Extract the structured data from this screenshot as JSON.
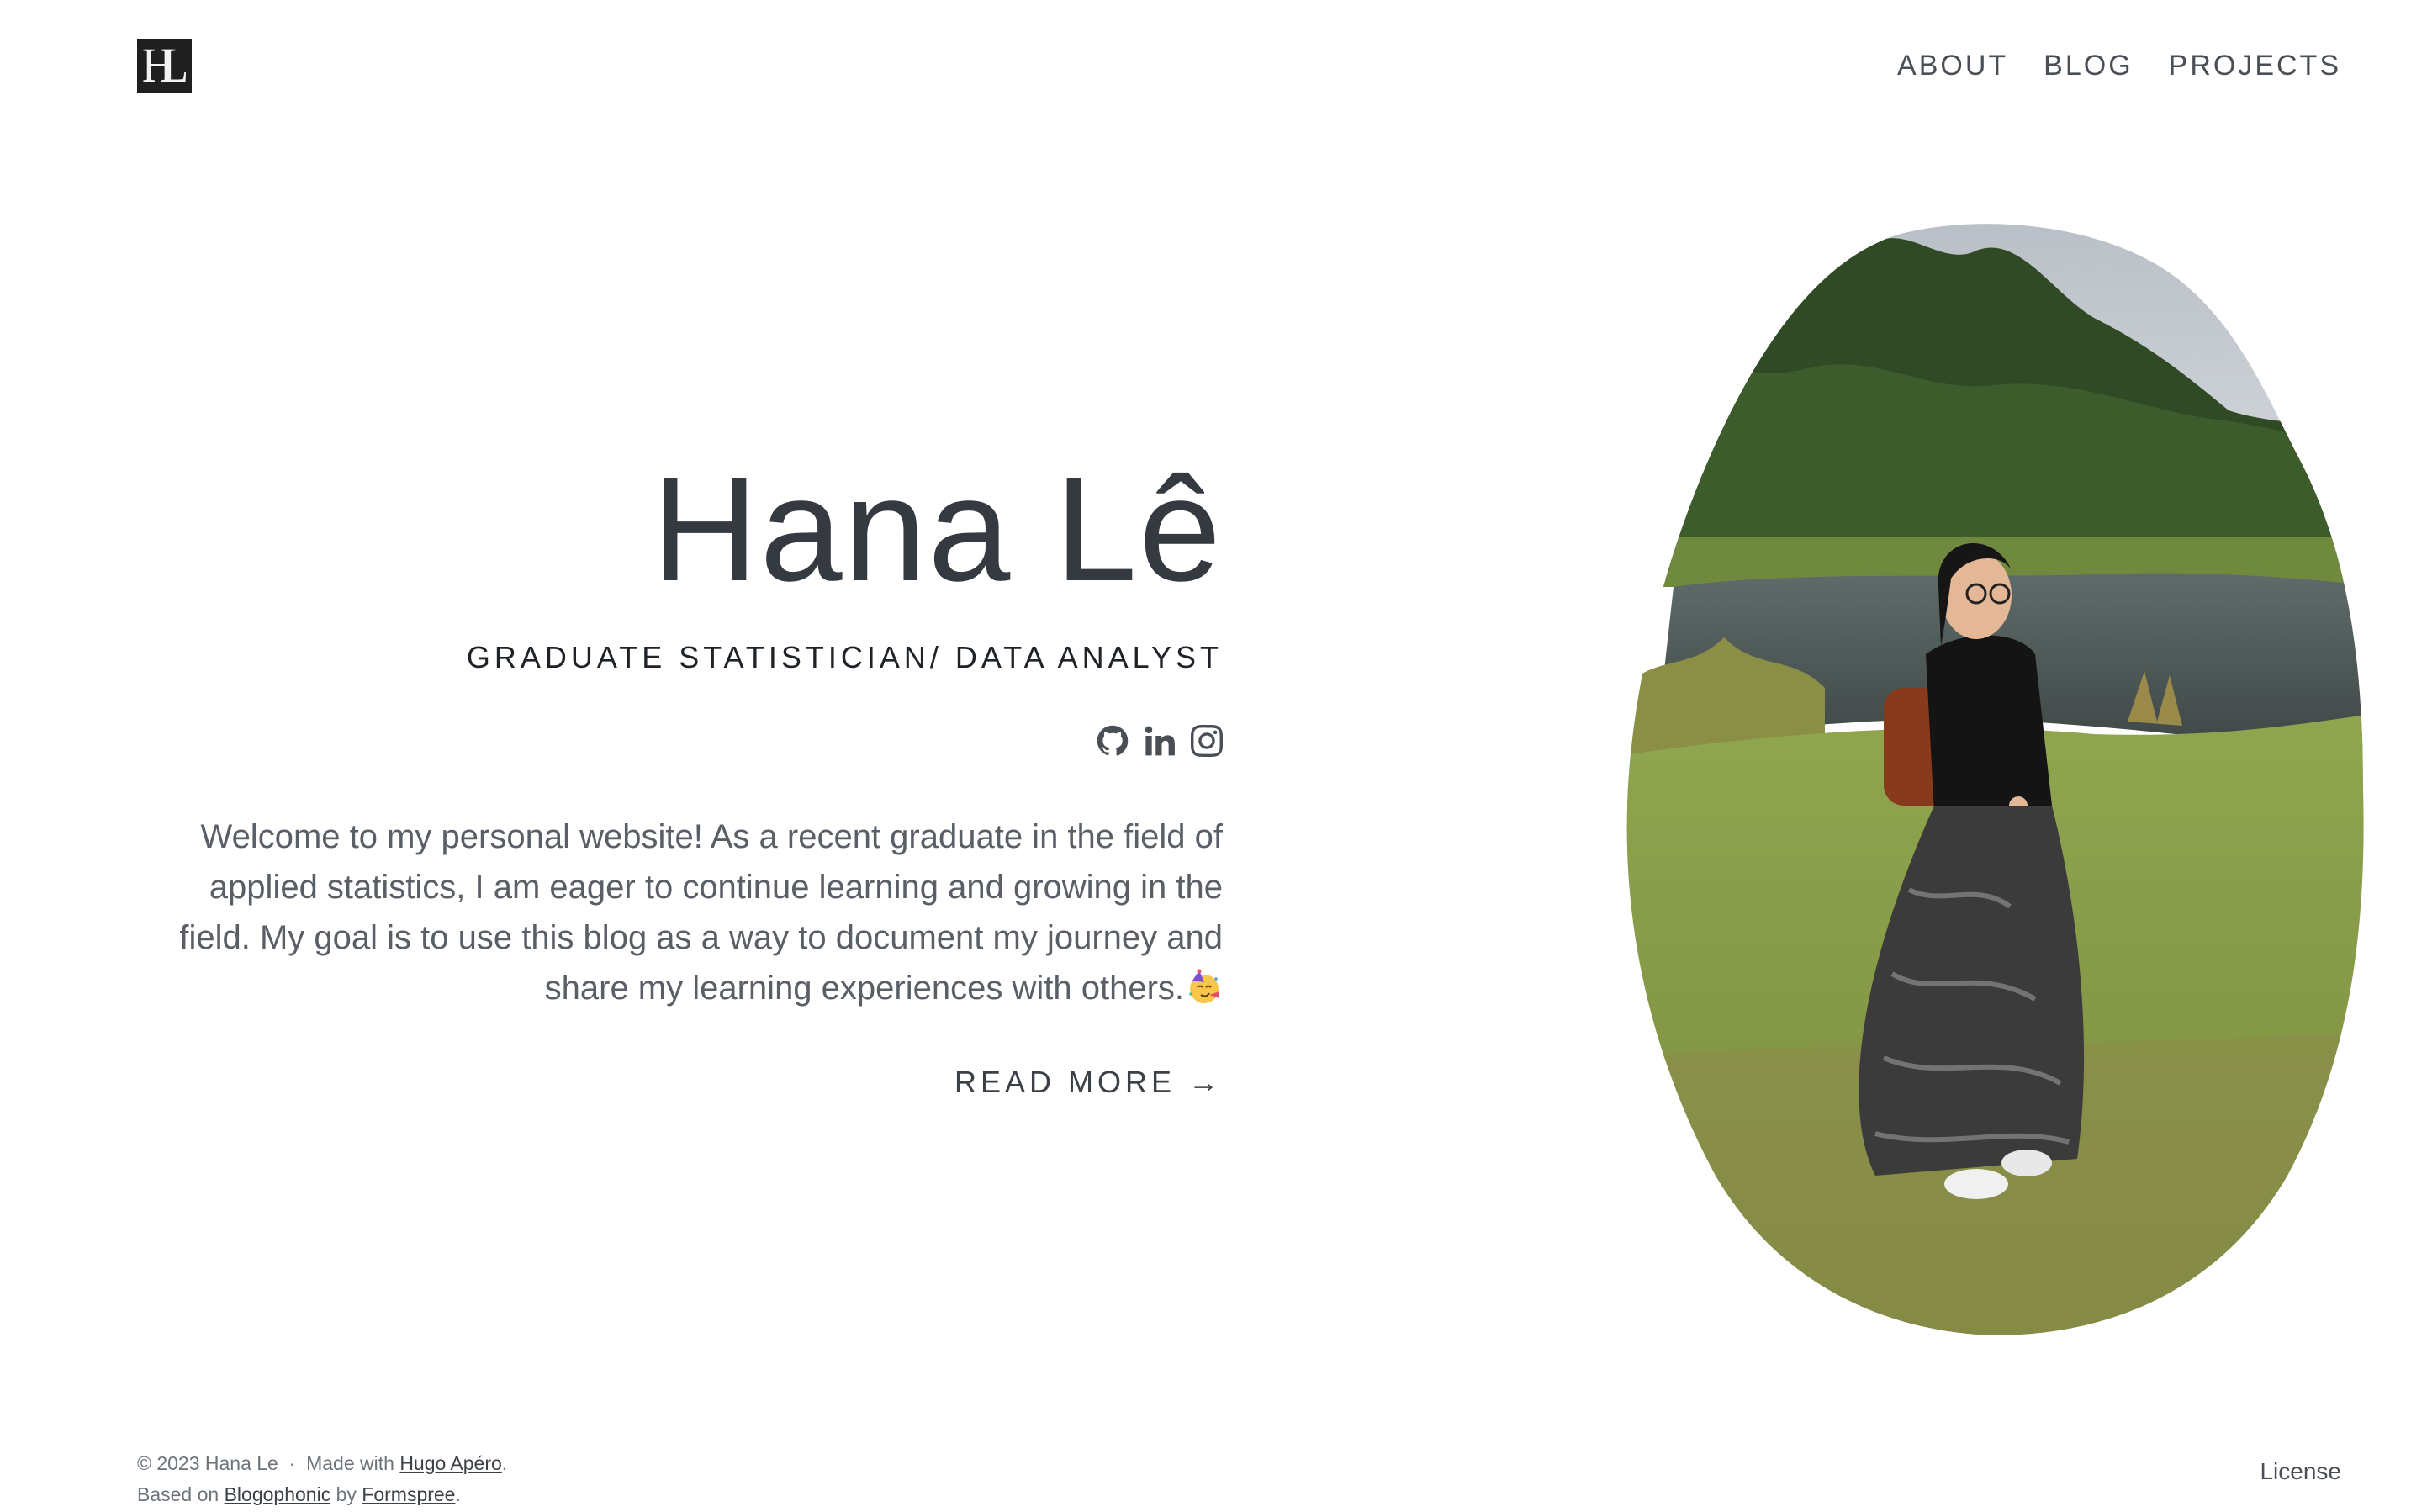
{
  "header": {
    "logo_text": "HL",
    "nav": [
      {
        "label": "ABOUT"
      },
      {
        "label": "BLOG"
      },
      {
        "label": "PROJECTS"
      }
    ]
  },
  "hero": {
    "title": "Hana Lê",
    "subtitle": "GRADUATE STATISTICIAN/ DATA ANALYST",
    "socials": [
      {
        "icon": "github-icon"
      },
      {
        "icon": "linkedin-icon"
      },
      {
        "icon": "instagram-icon"
      }
    ],
    "intro": "Welcome to my personal website! As a recent graduate in the field of applied statistics, I am eager to continue learning and growing in the field. My goal is to use this blog as a way to document my journey and share my learning experiences with others.",
    "intro_emoji": "partying-face-emoji",
    "read_more": "READ MORE →"
  },
  "footer": {
    "copyright": "© 2023 Hana Le",
    "separator": "·",
    "made_with_prefix": "Made with",
    "made_with_link": "Hugo Apéro",
    "period": ".",
    "based_on_prefix": "Based on",
    "based_on_link": "Blogophonic",
    "by_text": "by",
    "by_link": "Formspree",
    "license": "License"
  },
  "colors": {
    "text_dark": "#343a40",
    "text_muted": "#5a5f66",
    "background": "#ffffff",
    "logo_bg": "#1f1f1f"
  }
}
